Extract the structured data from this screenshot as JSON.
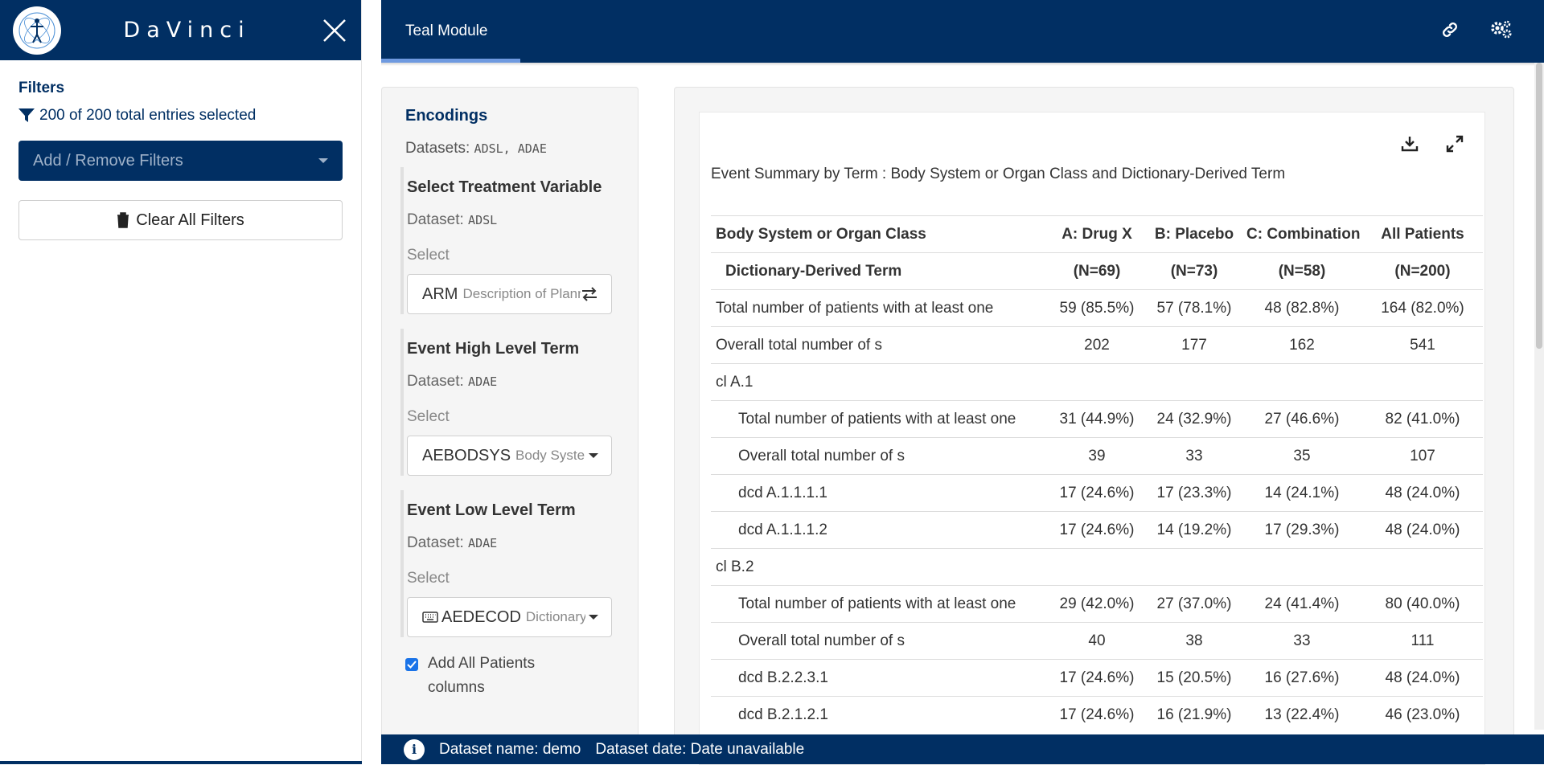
{
  "app": {
    "brand": "DaVinci"
  },
  "sidebar": {
    "filters_title": "Filters",
    "entries_text": "200 of 200 total entries selected",
    "filter_dropdown": "Add / Remove Filters",
    "clear_button": "Clear All Filters"
  },
  "topbar": {
    "tab_label": "Teal Module",
    "icons": [
      "link-icon",
      "gears-icon"
    ]
  },
  "encodings": {
    "title": "Encodings",
    "datasets_label": "Datasets:",
    "datasets_value": "ADSL, ADAE",
    "blocks": [
      {
        "title": "Select Treatment Variable",
        "dataset_label": "Dataset:",
        "dataset": "ADSL",
        "select_label": "Select",
        "value": "ARM",
        "sub": "Description of Planned Arm"
      },
      {
        "title": "Event High Level Term",
        "dataset_label": "Dataset:",
        "dataset": "ADAE",
        "select_label": "Select",
        "value": "AEBODSYS",
        "sub": "Body System or Organ Class"
      },
      {
        "title": "Event Low Level Term",
        "dataset_label": "Dataset:",
        "dataset": "ADAE",
        "select_label": "Select",
        "value": "AEDECOD",
        "sub": "Dictionary-Derived Term"
      }
    ],
    "checkbox_label_1": "Add All Patients",
    "checkbox_label_2": "columns",
    "checkbox_checked": true
  },
  "table": {
    "title": "Event Summary by Term : Body System or Organ Class and Dictionary-Derived Term",
    "header1": [
      "Body System or Organ Class",
      "A: Drug X",
      "B: Placebo",
      "C: Combination",
      "All Patients"
    ],
    "header2": [
      "Dictionary-Derived Term",
      "(N=69)",
      "(N=73)",
      "(N=58)",
      "(N=200)"
    ],
    "rows": [
      {
        "label": "Total number of patients with at least one",
        "v": [
          "59 (85.5%)",
          "57 (78.1%)",
          "48 (82.8%)",
          "164 (82.0%)"
        ]
      },
      {
        "label": "Overall total number of s",
        "v": [
          "202",
          "177",
          "162",
          "541"
        ]
      },
      {
        "label": "cl A.1",
        "v": [
          "",
          "",
          "",
          ""
        ]
      },
      {
        "label": "Total number of patients with at least one",
        "v": [
          "31 (44.9%)",
          "24 (32.9%)",
          "27 (46.6%)",
          "82 (41.0%)"
        ]
      },
      {
        "label": "Overall total number of s",
        "v": [
          "39",
          "33",
          "35",
          "107"
        ]
      },
      {
        "label": "dcd A.1.1.1.1",
        "v": [
          "17 (24.6%)",
          "17 (23.3%)",
          "14 (24.1%)",
          "48 (24.0%)"
        ]
      },
      {
        "label": "dcd A.1.1.1.2",
        "v": [
          "17 (24.6%)",
          "14 (19.2%)",
          "17 (29.3%)",
          "48 (24.0%)"
        ]
      },
      {
        "label": "cl B.2",
        "v": [
          "",
          "",
          "",
          ""
        ]
      },
      {
        "label": "Total number of patients with at least one",
        "v": [
          "29 (42.0%)",
          "27 (37.0%)",
          "24 (41.4%)",
          "80 (40.0%)"
        ]
      },
      {
        "label": "Overall total number of s",
        "v": [
          "40",
          "38",
          "33",
          "111"
        ]
      },
      {
        "label": "dcd B.2.2.3.1",
        "v": [
          "17 (24.6%)",
          "15 (20.5%)",
          "16 (27.6%)",
          "48 (24.0%)"
        ]
      },
      {
        "label": "dcd B.2.1.2.1",
        "v": [
          "17 (24.6%)",
          "16 (21.9%)",
          "13 (22.4%)",
          "46 (23.0%)"
        ]
      }
    ]
  },
  "footer": {
    "dataset_name": "Dataset name: demo",
    "dataset_date": "Dataset date: Date unavailable"
  },
  "colors": {
    "primary": "#012f63",
    "tab_accent": "#6f9ae0",
    "checkbox": "#1a73e8"
  }
}
